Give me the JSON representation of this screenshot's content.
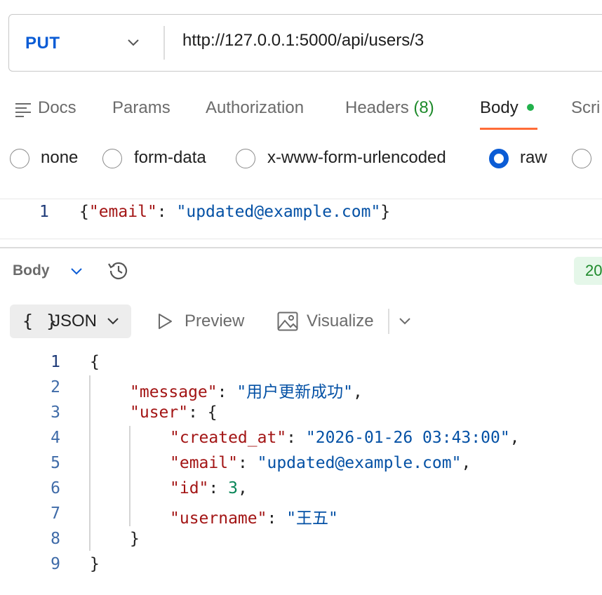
{
  "request": {
    "method": "PUT",
    "url": "http://127.0.0.1:5000/api/users/3"
  },
  "tabs": [
    {
      "label": "Docs"
    },
    {
      "label": "Params"
    },
    {
      "label": "Authorization"
    },
    {
      "label": "Headers",
      "count": "(8)"
    },
    {
      "label": "Body"
    },
    {
      "label": "Scri"
    }
  ],
  "body_types": [
    "none",
    "form-data",
    "x-www-form-urlencoded",
    "raw"
  ],
  "selected_body_type": "raw",
  "request_body": {
    "line_number": "1",
    "open": "{",
    "key": "\"email\"",
    "colon": ": ",
    "value": "\"updated@example.com\"",
    "close": "}"
  },
  "response": {
    "section_label": "Body",
    "status": "20",
    "view": {
      "format_label": "JSON",
      "format_braces": "{ }",
      "preview_label": "Preview",
      "visualize_label": "Visualize"
    },
    "lines": [
      {
        "n": "1",
        "tokens": [
          {
            "t": "{",
            "c": "j-punc"
          }
        ]
      },
      {
        "n": "2",
        "tokens": [
          {
            "t": "\"message\"",
            "c": "j-key"
          },
          {
            "t": ": ",
            "c": "j-punc"
          },
          {
            "t": "\"用户更新成功\"",
            "c": "j-str"
          },
          {
            "t": ",",
            "c": "j-punc"
          }
        ]
      },
      {
        "n": "3",
        "tokens": [
          {
            "t": "\"user\"",
            "c": "j-key"
          },
          {
            "t": ": {",
            "c": "j-punc"
          }
        ]
      },
      {
        "n": "4",
        "tokens": [
          {
            "t": "\"created_at\"",
            "c": "j-key"
          },
          {
            "t": ": ",
            "c": "j-punc"
          },
          {
            "t": "\"2026-01-26 03:43:00\"",
            "c": "j-str"
          },
          {
            "t": ",",
            "c": "j-punc"
          }
        ]
      },
      {
        "n": "5",
        "tokens": [
          {
            "t": "\"email\"",
            "c": "j-key"
          },
          {
            "t": ": ",
            "c": "j-punc"
          },
          {
            "t": "\"updated@example.com\"",
            "c": "j-str"
          },
          {
            "t": ",",
            "c": "j-punc"
          }
        ]
      },
      {
        "n": "6",
        "tokens": [
          {
            "t": "\"id\"",
            "c": "j-key"
          },
          {
            "t": ": ",
            "c": "j-punc"
          },
          {
            "t": "3",
            "c": "j-num"
          },
          {
            "t": ",",
            "c": "j-punc"
          }
        ]
      },
      {
        "n": "7",
        "tokens": [
          {
            "t": "\"username\"",
            "c": "j-key"
          },
          {
            "t": ": ",
            "c": "j-punc"
          },
          {
            "t": "\"王五\"",
            "c": "j-str"
          }
        ]
      },
      {
        "n": "8",
        "tokens": [
          {
            "t": "}",
            "c": "j-punc"
          }
        ]
      },
      {
        "n": "9",
        "tokens": [
          {
            "t": "}",
            "c": "j-punc"
          }
        ]
      }
    ]
  },
  "colors": {
    "method": "#0b5cd5",
    "active_tab_underline": "#ff6c37",
    "status_dot": "#22b14c",
    "json_key": "#a31515",
    "json_string": "#0451a5",
    "json_number": "#098658"
  },
  "icons": [
    "chevron-down-icon",
    "docs-icon",
    "history-icon",
    "play-icon",
    "image-icon"
  ]
}
